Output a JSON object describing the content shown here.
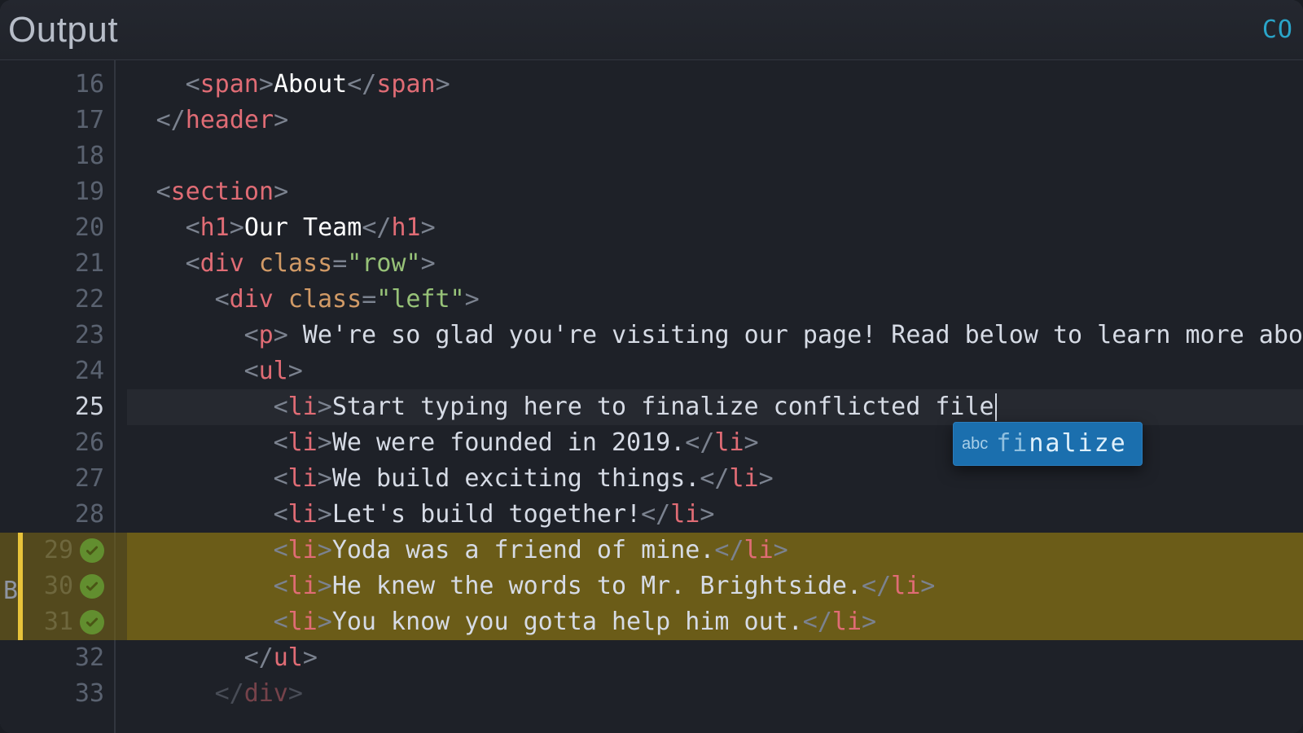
{
  "titlebar": {
    "title": "Output",
    "link": "CO"
  },
  "gutter": {
    "start": 16,
    "end": 33,
    "current": 25,
    "conflict_marker_label": "B",
    "checked_lines": [
      29,
      30,
      31
    ]
  },
  "autocomplete": {
    "kind_label": "abc",
    "suggestion": "finalize",
    "matched_prefix": "final"
  },
  "code": {
    "16": [
      {
        "indent": 2
      },
      {
        "cls": "t-punc",
        "txt": "<"
      },
      {
        "cls": "t-tag",
        "txt": "span"
      },
      {
        "cls": "t-punc",
        "txt": ">"
      },
      {
        "cls": "t-bright",
        "txt": "About"
      },
      {
        "cls": "t-punc",
        "txt": "</"
      },
      {
        "cls": "t-tag",
        "txt": "span"
      },
      {
        "cls": "t-punc",
        "txt": ">"
      }
    ],
    "17": [
      {
        "indent": 1
      },
      {
        "cls": "t-punc",
        "txt": "</"
      },
      {
        "cls": "t-tag",
        "txt": "header"
      },
      {
        "cls": "t-punc",
        "txt": ">"
      }
    ],
    "18": [],
    "19": [
      {
        "indent": 1
      },
      {
        "cls": "t-punc",
        "txt": "<"
      },
      {
        "cls": "t-tag",
        "txt": "section"
      },
      {
        "cls": "t-punc",
        "txt": ">"
      }
    ],
    "20": [
      {
        "indent": 2
      },
      {
        "cls": "t-punc",
        "txt": "<"
      },
      {
        "cls": "t-tag",
        "txt": "h1"
      },
      {
        "cls": "t-punc",
        "txt": ">"
      },
      {
        "cls": "t-bright",
        "txt": "Our Team"
      },
      {
        "cls": "t-punc",
        "txt": "</"
      },
      {
        "cls": "t-tag",
        "txt": "h1"
      },
      {
        "cls": "t-punc",
        "txt": ">"
      }
    ],
    "21": [
      {
        "indent": 2
      },
      {
        "cls": "t-punc",
        "txt": "<"
      },
      {
        "cls": "t-tag",
        "txt": "div"
      },
      {
        "cls": "t-text",
        "txt": " "
      },
      {
        "cls": "t-attr",
        "txt": "class"
      },
      {
        "cls": "t-punc",
        "txt": "="
      },
      {
        "cls": "t-str",
        "txt": "\"row\""
      },
      {
        "cls": "t-punc",
        "txt": ">"
      }
    ],
    "22": [
      {
        "indent": 3
      },
      {
        "cls": "t-punc",
        "txt": "<"
      },
      {
        "cls": "t-tag",
        "txt": "div"
      },
      {
        "cls": "t-text",
        "txt": " "
      },
      {
        "cls": "t-attr",
        "txt": "class"
      },
      {
        "cls": "t-punc",
        "txt": "="
      },
      {
        "cls": "t-str",
        "txt": "\"left\""
      },
      {
        "cls": "t-punc",
        "txt": ">"
      }
    ],
    "23": [
      {
        "indent": 4
      },
      {
        "cls": "t-punc",
        "txt": "<"
      },
      {
        "cls": "t-tag",
        "txt": "p"
      },
      {
        "cls": "t-punc",
        "txt": ">"
      },
      {
        "cls": "t-text",
        "txt": " We're so glad you're visiting our page! Read below to learn more abo"
      }
    ],
    "24": [
      {
        "indent": 4
      },
      {
        "cls": "t-punc",
        "txt": "<"
      },
      {
        "cls": "t-tag",
        "txt": "ul"
      },
      {
        "cls": "t-punc",
        "txt": ">"
      }
    ],
    "25": [
      {
        "indent": 5
      },
      {
        "cls": "t-punc",
        "txt": "<"
      },
      {
        "cls": "t-tag",
        "txt": "li"
      },
      {
        "cls": "t-punc",
        "txt": ">"
      },
      {
        "cls": "t-text",
        "txt": "Start typing here to finalize conflicted file"
      },
      {
        "caret": true
      }
    ],
    "26": [
      {
        "indent": 5
      },
      {
        "cls": "t-punc",
        "txt": "<"
      },
      {
        "cls": "t-tag",
        "txt": "li"
      },
      {
        "cls": "t-punc",
        "txt": ">"
      },
      {
        "cls": "t-text",
        "txt": "We were founded in 2019."
      },
      {
        "cls": "t-punc",
        "txt": "</"
      },
      {
        "cls": "t-tag",
        "txt": "li"
      },
      {
        "cls": "t-punc",
        "txt": ">"
      }
    ],
    "27": [
      {
        "indent": 5
      },
      {
        "cls": "t-punc",
        "txt": "<"
      },
      {
        "cls": "t-tag",
        "txt": "li"
      },
      {
        "cls": "t-punc",
        "txt": ">"
      },
      {
        "cls": "t-text",
        "txt": "We build exciting things."
      },
      {
        "cls": "t-punc",
        "txt": "</"
      },
      {
        "cls": "t-tag",
        "txt": "li"
      },
      {
        "cls": "t-punc",
        "txt": ">"
      }
    ],
    "28": [
      {
        "indent": 5
      },
      {
        "cls": "t-punc",
        "txt": "<"
      },
      {
        "cls": "t-tag",
        "txt": "li"
      },
      {
        "cls": "t-punc",
        "txt": ">"
      },
      {
        "cls": "t-text",
        "txt": "Let's build together!"
      },
      {
        "cls": "t-punc",
        "txt": "</"
      },
      {
        "cls": "t-tag",
        "txt": "li"
      },
      {
        "cls": "t-punc",
        "txt": ">"
      }
    ],
    "29": [
      {
        "indent": 5
      },
      {
        "cls": "t-punc",
        "txt": "<"
      },
      {
        "cls": "t-tag",
        "txt": "li"
      },
      {
        "cls": "t-punc",
        "txt": ">"
      },
      {
        "cls": "t-text",
        "txt": "Yoda was a friend of mine."
      },
      {
        "cls": "t-punc",
        "txt": "</"
      },
      {
        "cls": "t-tag",
        "txt": "li"
      },
      {
        "cls": "t-punc",
        "txt": ">"
      }
    ],
    "30": [
      {
        "indent": 5
      },
      {
        "cls": "t-punc",
        "txt": "<"
      },
      {
        "cls": "t-tag",
        "txt": "li"
      },
      {
        "cls": "t-punc",
        "txt": ">"
      },
      {
        "cls": "t-text",
        "txt": "He knew the words to Mr. Brightside."
      },
      {
        "cls": "t-punc",
        "txt": "</"
      },
      {
        "cls": "t-tag",
        "txt": "li"
      },
      {
        "cls": "t-punc",
        "txt": ">"
      }
    ],
    "31": [
      {
        "indent": 5
      },
      {
        "cls": "t-punc",
        "txt": "<"
      },
      {
        "cls": "t-tag",
        "txt": "li"
      },
      {
        "cls": "t-punc",
        "txt": ">"
      },
      {
        "cls": "t-text",
        "txt": "You know you gotta help him out."
      },
      {
        "cls": "t-punc",
        "txt": "</"
      },
      {
        "cls": "t-tag",
        "txt": "li"
      },
      {
        "cls": "t-punc",
        "txt": ">"
      }
    ],
    "32": [
      {
        "indent": 4
      },
      {
        "cls": "t-punc",
        "txt": "</"
      },
      {
        "cls": "t-tag",
        "txt": "ul"
      },
      {
        "cls": "t-punc",
        "txt": ">"
      }
    ],
    "33": [
      {
        "indent": 3
      },
      {
        "cls": "t-punc",
        "txt": "</"
      },
      {
        "cls": "t-tag",
        "txt": "div"
      },
      {
        "cls": "t-punc",
        "txt": ">"
      }
    ]
  }
}
